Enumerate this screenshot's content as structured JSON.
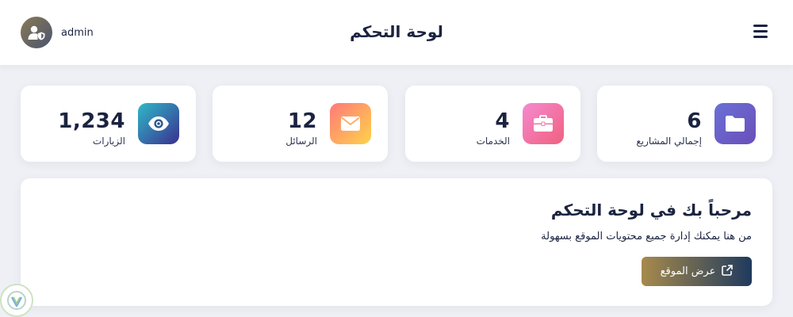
{
  "header": {
    "title": "لوحة التحكم",
    "username": "admin",
    "menu_icon": "hamburger-icon",
    "avatar_icon": "user-shield-icon"
  },
  "stats": [
    {
      "value": "6",
      "label": "إجمالي المشاريع",
      "icon": "folder-icon",
      "gradient": [
        "#6a70d6",
        "#6a4fb8"
      ]
    },
    {
      "value": "4",
      "label": "الخدمات",
      "icon": "briefcase-icon",
      "gradient": [
        "#f58ad0",
        "#f0607e"
      ]
    },
    {
      "value": "12",
      "label": "الرسائل",
      "icon": "envelope-icon",
      "gradient": [
        "#ff7a7a",
        "#ffd24a"
      ]
    },
    {
      "value": "1,234",
      "label": "الزيارات",
      "icon": "eye-icon",
      "gradient": [
        "#2fb9c8",
        "#3b2f8f"
      ]
    }
  ],
  "welcome": {
    "heading": "مرحباً بك في لوحة التحكم",
    "text": "من هنا يمكنك إدارة جميع محتويات الموقع بسهولة",
    "button_label": "عرض الموقع",
    "button_icon": "external-link-icon"
  },
  "colors": {
    "primary": "#1b2340",
    "background": "#eef0f5",
    "button_gradient": [
      "#a78a4c",
      "#1f3a5e"
    ]
  }
}
